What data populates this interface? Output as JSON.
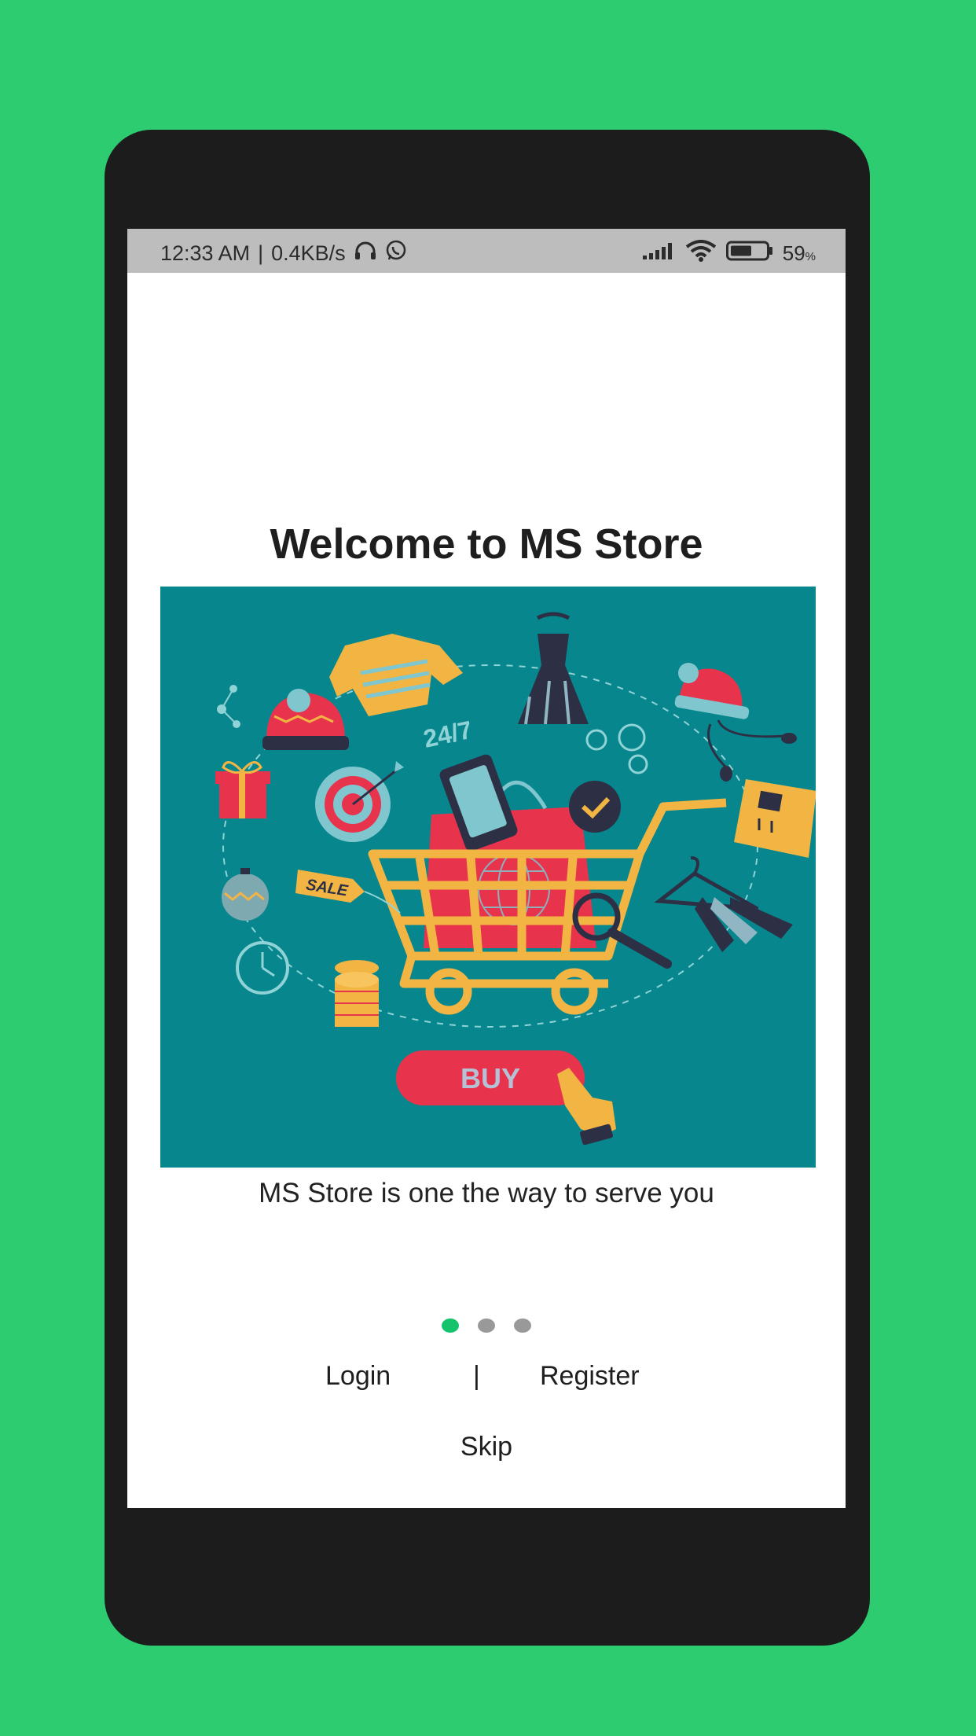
{
  "status_bar": {
    "time": "12:33 AM",
    "separator": "|",
    "speed": "0.4KB/s",
    "battery_percent": "59",
    "battery_unit": "%",
    "battery_level": 0.59,
    "icons_left": [
      "headphones-icon",
      "whatsapp-icon"
    ],
    "icons_right": [
      "signal-icon",
      "wifi-icon",
      "battery-icon"
    ]
  },
  "onboarding": {
    "title": "Welcome to MS Store",
    "subtitle": "MS Store is one the way to serve you",
    "hero_text": {
      "badge_24_7": "24/7",
      "sale_tag": "SALE",
      "buy_button": "BUY"
    },
    "pager": {
      "count": 3,
      "active_index": 0
    }
  },
  "actions": {
    "login": "Login",
    "separator": "|",
    "register": "Register",
    "skip": "Skip"
  },
  "colors": {
    "background": "#2ecc71",
    "phone_body": "#1c1c1c",
    "hero_bg": "#07868d",
    "active_dot": "#14c36b",
    "inactive_dot": "#999999"
  }
}
